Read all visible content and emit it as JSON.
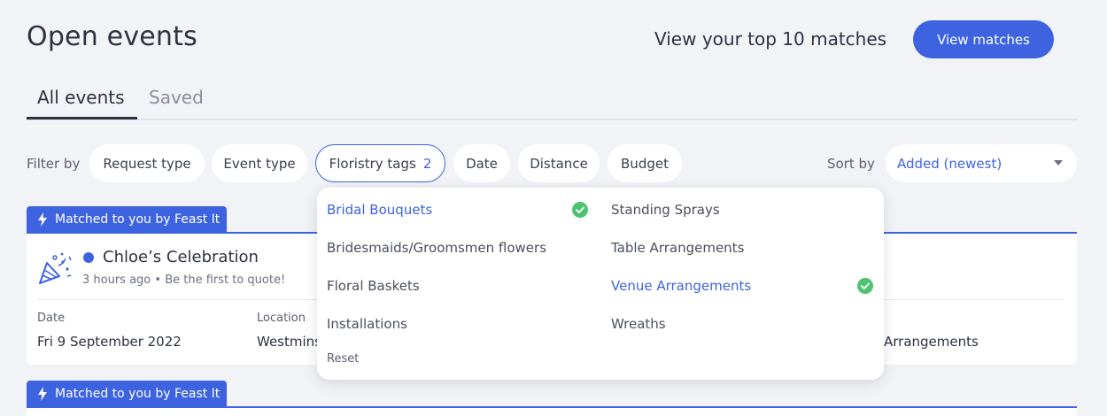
{
  "header": {
    "title": "Open events",
    "top_matches_text": "View your top 10 matches",
    "view_matches_label": "View matches"
  },
  "tabs": [
    {
      "label": "All events",
      "active": true
    },
    {
      "label": "Saved",
      "active": false
    }
  ],
  "filters": {
    "label": "Filter by",
    "chips": [
      {
        "label": "Request type"
      },
      {
        "label": "Event type"
      },
      {
        "label": "Floristry tags",
        "count": "2",
        "active": true
      },
      {
        "label": "Date"
      },
      {
        "label": "Distance"
      },
      {
        "label": "Budget"
      }
    ]
  },
  "sort": {
    "label": "Sort by",
    "value": "Added (newest)"
  },
  "floristry_dropdown": {
    "left_column": [
      {
        "label": "Bridal Bouquets",
        "selected": true
      },
      {
        "label": "Bridesmaids/Groomsmen flowers",
        "selected": false
      },
      {
        "label": "Floral Baskets",
        "selected": false
      },
      {
        "label": "Installations",
        "selected": false
      }
    ],
    "right_column": [
      {
        "label": "Standing Sprays",
        "selected": false
      },
      {
        "label": "Table Arrangements",
        "selected": false
      },
      {
        "label": "Venue Arrangements",
        "selected": true
      },
      {
        "label": "Wreaths",
        "selected": false
      }
    ],
    "reset_label": "Reset"
  },
  "events": [
    {
      "badge": "Matched to you by Feast It",
      "name": "Chloe’s Celebration",
      "meta": "3 hours ago • Be the first to quote!",
      "date_label": "Date",
      "date_value": "Fri 9 September 2022",
      "location_label": "Location",
      "location_value": "Westminster",
      "tags_value": "Arrangements"
    },
    {
      "badge": "Matched to you by Feast It"
    }
  ],
  "colors": {
    "accent": "#3d63e0",
    "check": "#4cc36e",
    "background": "#f2f3f6"
  }
}
